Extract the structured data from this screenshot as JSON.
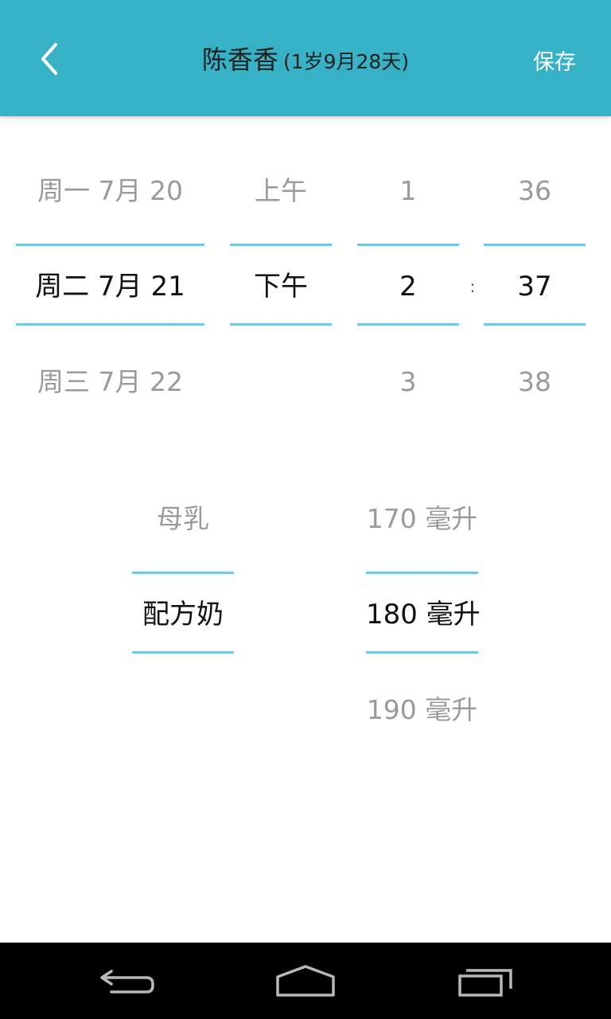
{
  "header": {
    "name": "陈香香",
    "age": "(1岁9月28天)",
    "save_label": "保存",
    "back_icon": "chevron-left-icon"
  },
  "datetime_picker": {
    "date": {
      "prev": "周一 7月 20",
      "current": "周二 7月 21",
      "next": "周三 7月 22"
    },
    "period": {
      "prev": "上午",
      "current": "下午",
      "next": ""
    },
    "hour": {
      "prev": "1",
      "current": "2",
      "next": "3"
    },
    "separator": ":",
    "minute": {
      "prev": "36",
      "current": "37",
      "next": "38"
    }
  },
  "feed_picker": {
    "type": {
      "prev": "母乳",
      "current": "配方奶",
      "next": ""
    },
    "amount": {
      "prev": "170 毫升",
      "current": "180 毫升",
      "next": "190 毫升"
    }
  },
  "navbar": {
    "back_icon": "back-arrow-icon",
    "home_icon": "home-icon",
    "recents_icon": "recent-apps-icon"
  },
  "colors": {
    "header_bg": "#36b1c6",
    "selection_line": "#74c7de",
    "navbar_bg": "#000000"
  }
}
